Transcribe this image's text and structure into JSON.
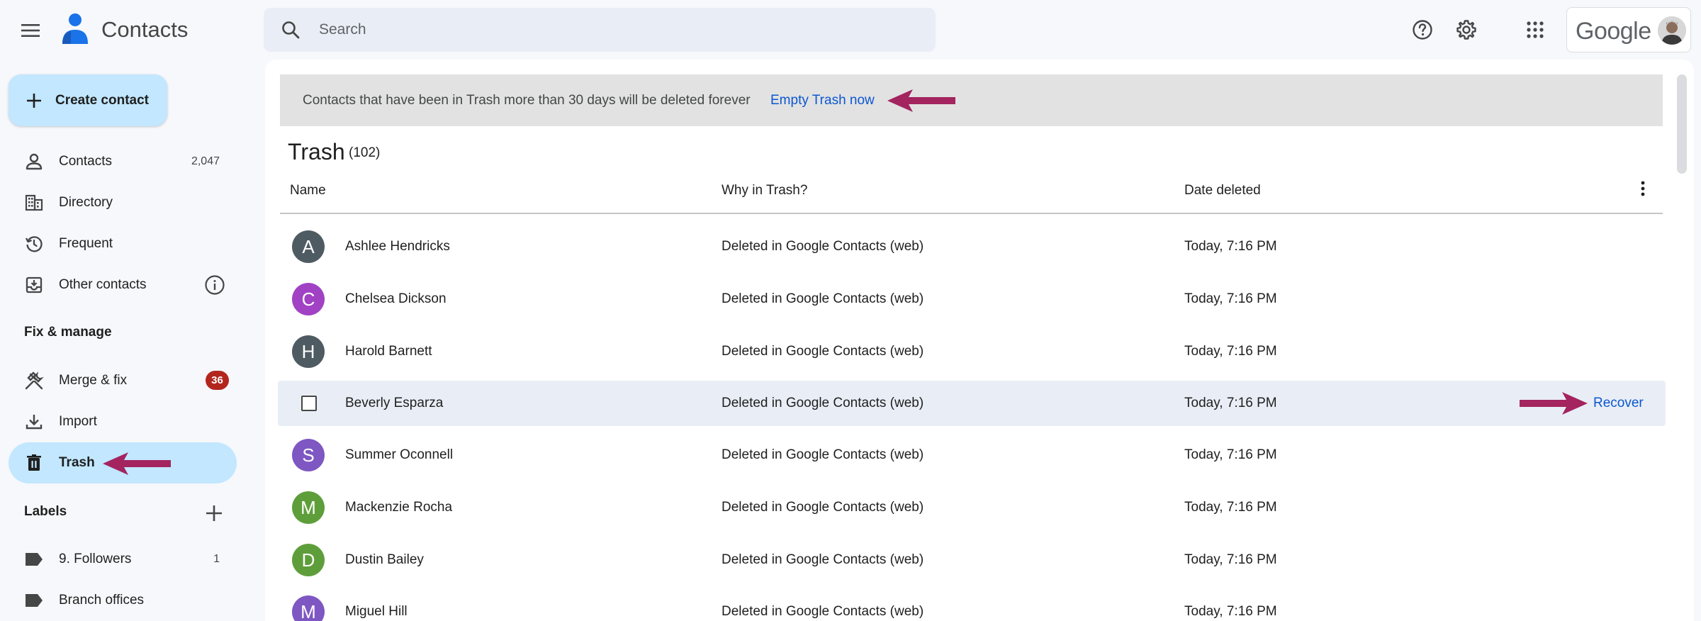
{
  "header": {
    "app_title": "Contacts",
    "search_placeholder": "Search",
    "account_brand": "Google"
  },
  "sidebar": {
    "create_label": "Create contact",
    "items": [
      {
        "label": "Contacts",
        "count": "2,047",
        "icon": "person-icon"
      },
      {
        "label": "Directory",
        "icon": "building-icon"
      },
      {
        "label": "Frequent",
        "icon": "history-icon"
      },
      {
        "label": "Other contacts",
        "icon": "inbox-download-icon"
      }
    ],
    "fix_manage_title": "Fix & manage",
    "fix_items": [
      {
        "label": "Merge & fix",
        "badge": "36",
        "icon": "merge-fix-icon"
      },
      {
        "label": "Import",
        "icon": "download-icon"
      },
      {
        "label": "Trash",
        "icon": "trash-icon"
      }
    ],
    "labels_title": "Labels",
    "labels": [
      {
        "label": "9. Followers",
        "count": "1",
        "icon": "label-icon"
      },
      {
        "label": "Branch offices",
        "icon": "label-icon"
      }
    ]
  },
  "banner": {
    "text": "Contacts that have been in Trash more than 30 days will be deleted forever",
    "link": "Empty Trash now"
  },
  "trash": {
    "title": "Trash",
    "count": "(102)",
    "columns": [
      "Name",
      "Why in Trash?",
      "Date deleted"
    ],
    "recover_label": "Recover",
    "rows": [
      {
        "initial": "A",
        "name": "Ashlee Hendricks",
        "reason": "Deleted in Google Contacts (web)",
        "date": "Today, 7:16 PM",
        "color": "#4f5b62"
      },
      {
        "initial": "C",
        "name": "Chelsea Dickson",
        "reason": "Deleted in Google Contacts (web)",
        "date": "Today, 7:16 PM",
        "color": "#a142c4"
      },
      {
        "initial": "H",
        "name": "Harold Barnett",
        "reason": "Deleted in Google Contacts (web)",
        "date": "Today, 7:16 PM",
        "color": "#4f5b62"
      },
      {
        "initial": "",
        "name": "Beverly Esparza",
        "reason": "Deleted in Google Contacts (web)",
        "date": "Today, 7:16 PM",
        "color": ""
      },
      {
        "initial": "S",
        "name": "Summer Oconnell",
        "reason": "Deleted in Google Contacts (web)",
        "date": "Today, 7:16 PM",
        "color": "#7e57c2"
      },
      {
        "initial": "M",
        "name": "Mackenzie Rocha",
        "reason": "Deleted in Google Contacts (web)",
        "date": "Today, 7:16 PM",
        "color": "#5e9e3a"
      },
      {
        "initial": "D",
        "name": "Dustin Bailey",
        "reason": "Deleted in Google Contacts (web)",
        "date": "Today, 7:16 PM",
        "color": "#5e9e3a"
      },
      {
        "initial": "M",
        "name": "Miguel Hill",
        "reason": "Deleted in Google Contacts (web)",
        "date": "Today, 7:16 PM",
        "color": "#7e57c2"
      }
    ]
  },
  "colors": {
    "accent_blue": "#0b57d0",
    "active_nav": "#c2e7ff",
    "annotation_arrow": "#a3245f",
    "badge_red": "#b3261e"
  }
}
